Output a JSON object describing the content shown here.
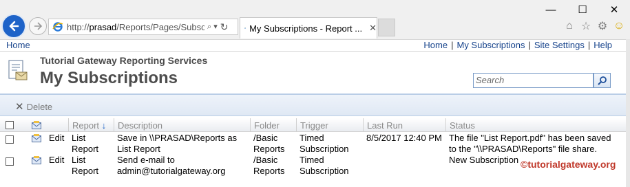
{
  "browser": {
    "address_prefix": "http://",
    "address_host": "prasad",
    "address_rest": "/Reports/Pages/Subscri",
    "tab_title": "My Subscriptions - Report ...",
    "controls": {
      "minimize": "—",
      "maximize": "☐",
      "close": "✕"
    }
  },
  "topnav": {
    "home": "Home",
    "links": [
      "Home",
      "My Subscriptions",
      "Site Settings",
      "Help"
    ],
    "separator": "|"
  },
  "header": {
    "site_name": "Tutorial Gateway Reporting Services",
    "page_title": "My Subscriptions",
    "search_placeholder": "Search"
  },
  "toolbar": {
    "delete_label": "Delete"
  },
  "table": {
    "columns": [
      "Report",
      "Description",
      "Folder",
      "Trigger",
      "Last Run",
      "Status"
    ],
    "sort_indicator": "↓",
    "edit_label": "Edit",
    "rows": [
      {
        "report": [
          "List",
          "Report"
        ],
        "description": [
          "Save in \\\\PRASAD\\Reports as",
          "List Report"
        ],
        "folder": [
          "/Basic",
          "Reports"
        ],
        "trigger": [
          "Timed",
          "Subscription"
        ],
        "last_run": "8/5/2017 12:40 PM",
        "status": [
          "The file \"List Report.pdf\" has been saved",
          "to the \"\\\\PRASAD\\Reports\" file share."
        ]
      },
      {
        "report": [
          "List",
          "Report"
        ],
        "description": [
          "Send e-mail to",
          "admin@tutorialgateway.org"
        ],
        "folder": [
          "/Basic",
          "Reports"
        ],
        "trigger": [
          "Timed",
          "Subscription"
        ],
        "last_run": "",
        "status": [
          "New Subscription",
          ""
        ]
      }
    ]
  },
  "watermark": "©tutorialgateway.org",
  "colors": {
    "link": "#15428b",
    "back_button": "#1e63c8",
    "watermark": "#c0392b"
  }
}
